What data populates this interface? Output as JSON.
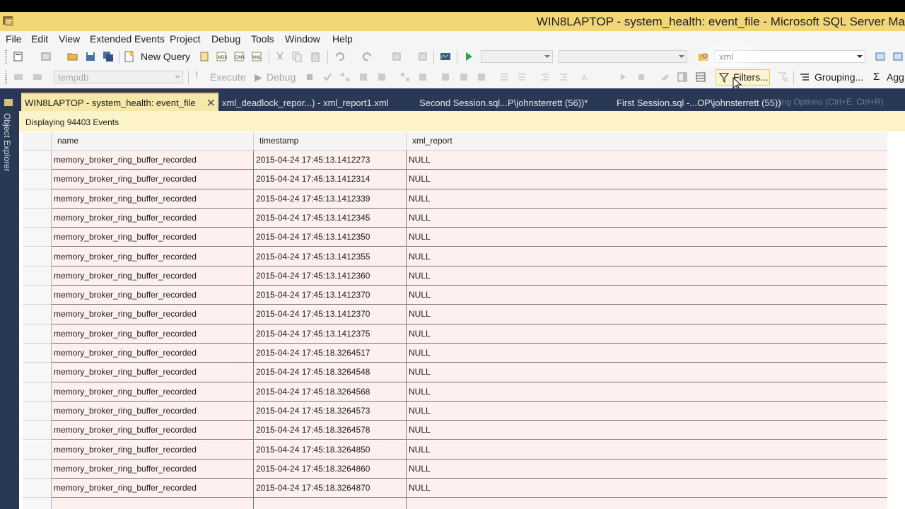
{
  "window": {
    "title": "WIN8LAPTOP - system_health: event_file - Microsoft SQL Server Ma"
  },
  "menu": [
    "File",
    "Edit",
    "View",
    "Extended Events",
    "Project",
    "Debug",
    "Tools",
    "Window",
    "Help"
  ],
  "toolbar1": {
    "new_query_label": "New Query",
    "search_box_value": "xml"
  },
  "toolbar2": {
    "database_value": "tempdb",
    "execute_label": "Execute",
    "debug_label": "Debug",
    "filters_label": "Filters...",
    "grouping_label": "Grouping...",
    "aggregation_label": "Agg"
  },
  "sidebar": {
    "object_explorer_label": "Object Explorer"
  },
  "tabs": [
    {
      "label": "WIN8LAPTOP - system_health: event_file",
      "active": true
    },
    {
      "label": "xml_deadlock_repor...) - xml_report1.xml",
      "active": false
    },
    {
      "label": "Second Session.sql...P\\johnsterrett (56))*",
      "active": false
    },
    {
      "label": "First Session.sql -...OP\\johnsterrett (55))",
      "active": false
    }
  ],
  "tab_ghost_text": "ing Options (Ctrl+E, Ctrl+R)",
  "status": {
    "events_text": "Displaying 94403 Events"
  },
  "grid": {
    "columns": [
      "name",
      "timestamp",
      "xml_report"
    ],
    "rows": [
      [
        "memory_broker_ring_buffer_recorded",
        "2015-04-24 17:45:13.1412273",
        "NULL"
      ],
      [
        "memory_broker_ring_buffer_recorded",
        "2015-04-24 17:45:13.1412314",
        "NULL"
      ],
      [
        "memory_broker_ring_buffer_recorded",
        "2015-04-24 17:45:13.1412339",
        "NULL"
      ],
      [
        "memory_broker_ring_buffer_recorded",
        "2015-04-24 17:45:13.1412345",
        "NULL"
      ],
      [
        "memory_broker_ring_buffer_recorded",
        "2015-04-24 17:45:13.1412350",
        "NULL"
      ],
      [
        "memory_broker_ring_buffer_recorded",
        "2015-04-24 17:45:13.1412355",
        "NULL"
      ],
      [
        "memory_broker_ring_buffer_recorded",
        "2015-04-24 17:45:13.1412360",
        "NULL"
      ],
      [
        "memory_broker_ring_buffer_recorded",
        "2015-04-24 17:45:13.1412370",
        "NULL"
      ],
      [
        "memory_broker_ring_buffer_recorded",
        "2015-04-24 17:45:13.1412370",
        "NULL"
      ],
      [
        "memory_broker_ring_buffer_recorded",
        "2015-04-24 17:45:13.1412375",
        "NULL"
      ],
      [
        "memory_broker_ring_buffer_recorded",
        "2015-04-24 17:45:18.3264517",
        "NULL"
      ],
      [
        "memory_broker_ring_buffer_recorded",
        "2015-04-24 17:45:18.3264548",
        "NULL"
      ],
      [
        "memory_broker_ring_buffer_recorded",
        "2015-04-24 17:45:18.3264568",
        "NULL"
      ],
      [
        "memory_broker_ring_buffer_recorded",
        "2015-04-24 17:45:18.3264573",
        "NULL"
      ],
      [
        "memory_broker_ring_buffer_recorded",
        "2015-04-24 17:45:18.3264578",
        "NULL"
      ],
      [
        "memory_broker_ring_buffer_recorded",
        "2015-04-24 17:45:18.3264850",
        "NULL"
      ],
      [
        "memory_broker_ring_buffer_recorded",
        "2015-04-24 17:45:18.3264860",
        "NULL"
      ],
      [
        "memory_broker_ring_buffer_recorded",
        "2015-04-24 17:45:18.3264870",
        "NULL"
      ]
    ]
  },
  "colors": {
    "title_bar": "#f3d676",
    "chrome_dark": "#293955",
    "row_bg": "#fdf0ef",
    "status_bg": "#fcf3c9"
  }
}
